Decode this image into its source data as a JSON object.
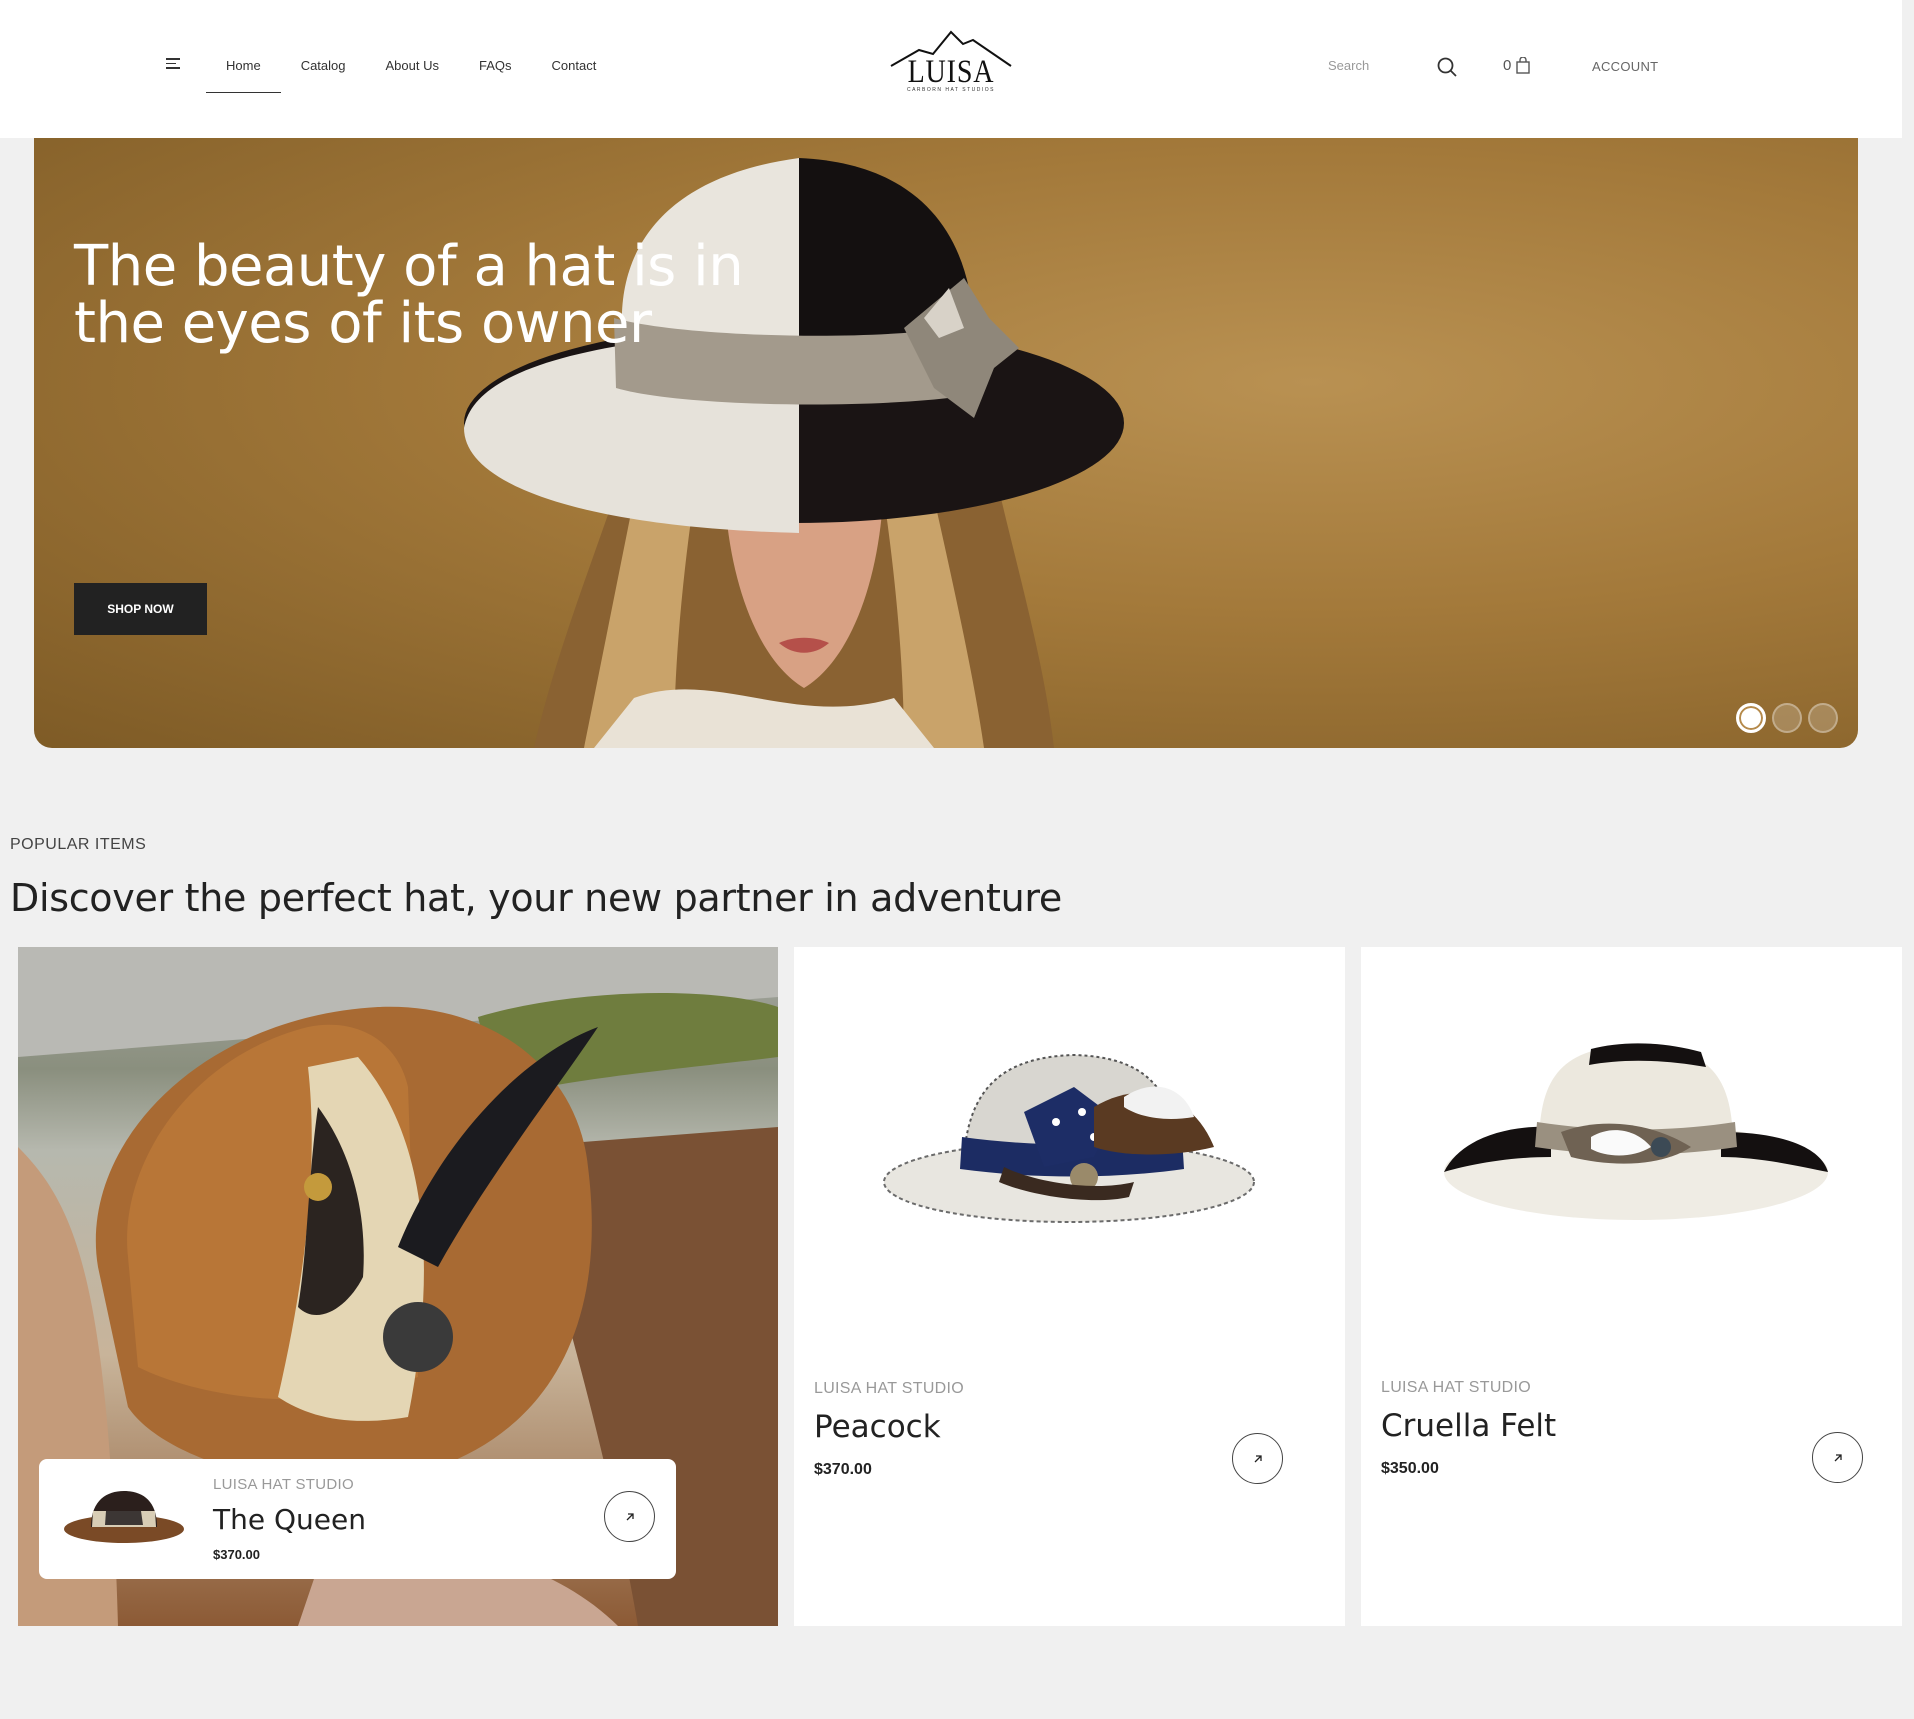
{
  "header": {
    "nav": [
      "Home",
      "Catalog",
      "About Us",
      "FAQs",
      "Contact"
    ],
    "logo": {
      "name": "LUISA",
      "tagline": "CARBORN HAT STUDIOS"
    },
    "search_placeholder": "Search",
    "cart_count": "0",
    "account_label": "ACCOUNT"
  },
  "hero": {
    "title": "The beauty of a hat is in the eyes of its owner",
    "cta_label": "SHOP NOW",
    "slides_total": 3,
    "active_slide": 1
  },
  "popular": {
    "label": "POPULAR ITEMS",
    "title": "Discover the perfect hat, your new partner in adventure",
    "featured": {
      "brand": "LUISA HAT STUDIO",
      "name": "The Queen",
      "price": "$370.00"
    },
    "products": [
      {
        "brand": "LUISA HAT STUDIO",
        "name": "Peacock",
        "price": "$370.00"
      },
      {
        "brand": "LUISA HAT STUDIO",
        "name": "Cruella Felt",
        "price": "$350.00"
      }
    ]
  },
  "colors": {
    "accent": "#222222",
    "hero_bg": "#a3793a",
    "page_bg": "#f0f0f0"
  }
}
